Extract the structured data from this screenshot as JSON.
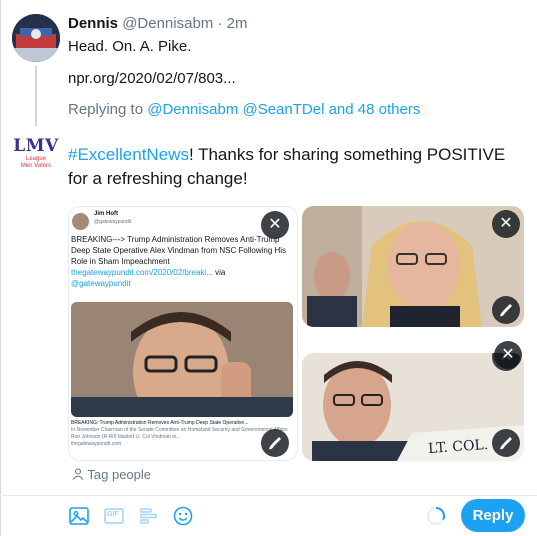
{
  "original_tweet": {
    "name": "Dennis",
    "handle": "@Dennisabm",
    "separator": "·",
    "time": "2m",
    "text": "Head. On. A. Pike.",
    "link": "npr.org/2020/02/07/803...",
    "replying_prefix": "Replying to",
    "replying_handles": "@Dennisabm @SeanTDel and 48 others"
  },
  "reply": {
    "avatar_text": "LMV",
    "avatar_sub1": "League",
    "avatar_sub2": "Men Voters",
    "hashtag": "#ExcellentNews",
    "text_rest": "! Thanks for sharing something POSITIVE for a refreshing change!"
  },
  "media": {
    "embedded_tweet": {
      "name": "Jim Hoft",
      "handle": "@gatewaypundit",
      "body": "BREAKING---> Trump Administration Removes Anti-Trump Deep State Operative Alex Vindman from NSC Following His Role in Sham Impeachment",
      "url": "thegatewaypundit.com/2020/02/breaki...",
      "via": "via",
      "via_handle": "@gatewaypundit",
      "caption_title": "BREAKING: Trump Administration Removes Anti-Trump Deep State Operative...",
      "caption_body": "In November Chairman of the Senate Committee on Homeland Security and Governmental Affairs Ron Johnson (R-WI) blasted Lt. Col Vindman in...",
      "caption_domain": "thegatewaypundit.com"
    },
    "nameplate_text": "LT. COL.",
    "close_glyph": "✕",
    "tag_people": "Tag people"
  },
  "toolbar": {
    "icons": [
      "image-icon",
      "gif-icon",
      "poll-icon",
      "emoji-icon"
    ],
    "gif_label": "GIF",
    "reply_label": "Reply"
  },
  "colors": {
    "accent": "#1da1f2",
    "text": "#14171a",
    "muted": "#657786"
  }
}
